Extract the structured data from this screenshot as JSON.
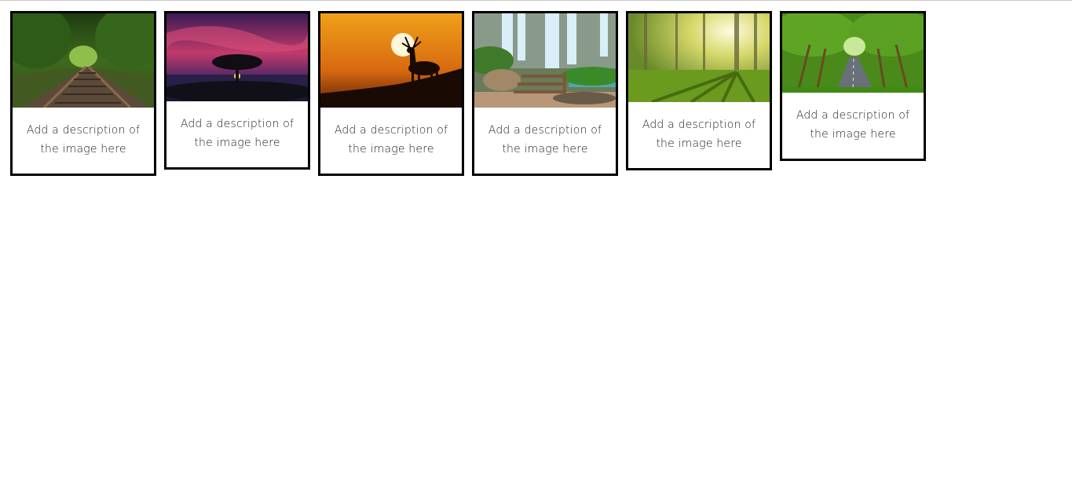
{
  "gallery": {
    "cards": [
      {
        "image_icon": "railway-track-forest-image",
        "caption": "Add a description of the image here"
      },
      {
        "image_icon": "tree-sunset-sky-image",
        "caption": "Add a description of the image here"
      },
      {
        "image_icon": "deer-silhouette-sunset-image",
        "caption": "Add a description of the image here"
      },
      {
        "image_icon": "waterfall-stairs-image",
        "caption": "Add a description of the image here"
      },
      {
        "image_icon": "sunlit-forest-image",
        "caption": "Add a description of the image here"
      },
      {
        "image_icon": "tree-lined-road-image",
        "caption": "Add a description of the image here"
      }
    ]
  }
}
